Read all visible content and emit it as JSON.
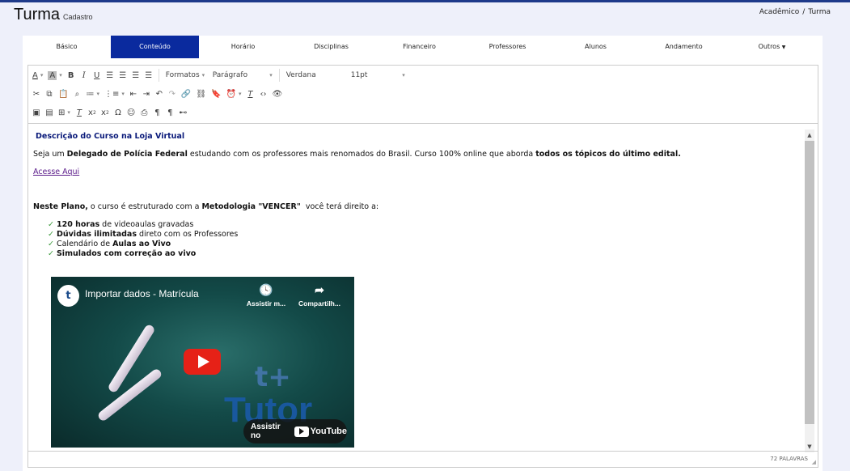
{
  "header": {
    "title": "Turma",
    "subtitle": "Cadastro",
    "breadcrumb": [
      "Acadêmico",
      "Turma"
    ],
    "breadcrumb_sep": "/"
  },
  "tabs": [
    {
      "label": "Básico",
      "active": false
    },
    {
      "label": "Conteúdo",
      "active": true
    },
    {
      "label": "Horário",
      "active": false
    },
    {
      "label": "Disciplinas",
      "active": false
    },
    {
      "label": "Financeiro",
      "active": false
    },
    {
      "label": "Professores",
      "active": false
    },
    {
      "label": "Alunos",
      "active": false
    },
    {
      "label": "Andamento",
      "active": false
    },
    {
      "label": "Outros",
      "active": false
    }
  ],
  "toolbar": {
    "formats_label": "Formatos",
    "paragraph_label": "Parágrafo",
    "font_label": "Verdana",
    "size_label": "11pt"
  },
  "content": {
    "heading": "Descrição do Curso na Loja Virtual",
    "line1_a": "Seja um ",
    "line1_b": "Delegado de Polícia Federal",
    "line1_c": " estudando com os professores mais renomados do Brasil. Curso 100% online que aborda ",
    "line1_d": "todos os tópicos do último edital.",
    "link": "Acesse Aqui",
    "plan_a": "Neste Plano,",
    "plan_b": " o curso é estruturado com a ",
    "plan_c": "Metodologia \"VENCER\"",
    "plan_d": "  você terá direito a:",
    "items": [
      {
        "bold": "120 horas",
        "rest": " de videoaulas gravadas",
        "bold_first": true
      },
      {
        "bold": "Dúvidas ilimitadas",
        "rest": " direto com os Professores",
        "bold_first": true
      },
      {
        "bold": "Aulas ao Vivo",
        "rest": "Calendário de ",
        "bold_first": false
      },
      {
        "bold": "Simulados com correção ao vivo",
        "rest": "",
        "bold_first": true
      }
    ],
    "check_glyph": "✓"
  },
  "video": {
    "title": "Importar dados - Matrícula",
    "watch_later": "Assistir m...",
    "share": "Compartilh...",
    "watch_on": "Assistir no",
    "youtube": "YouTube",
    "logo_text": "Tutor"
  },
  "status": {
    "words": "72 PALAVRAS"
  },
  "colors": {
    "accent": "#0a2a9e",
    "heading": "#0a1a7a",
    "link": "#5a1a8a",
    "check": "#3a9a3a"
  }
}
